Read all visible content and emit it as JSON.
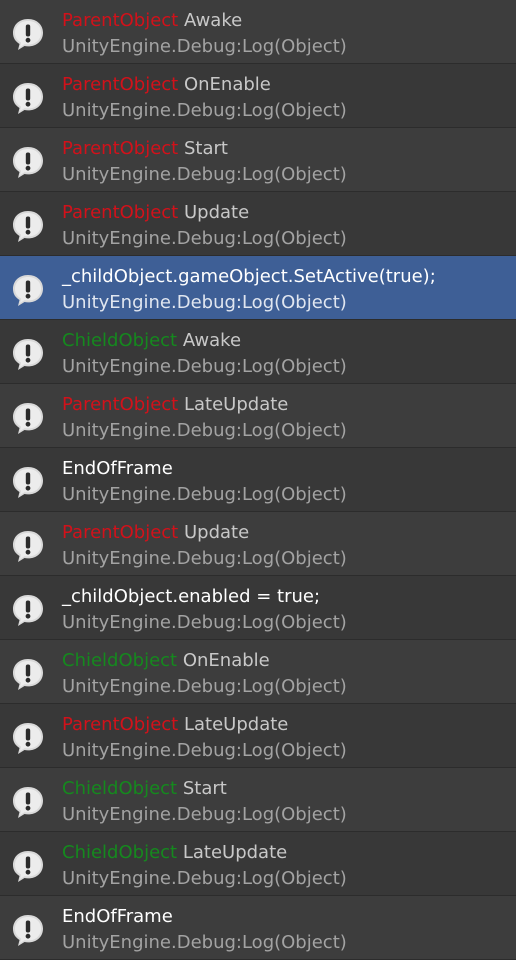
{
  "colors": {
    "parent": "#d2111a",
    "child": "#15891e",
    "message": "#c8c8c8",
    "plain": "#ffffff",
    "stack": "#a3a3a3",
    "selected_bg": "#3e5f96"
  },
  "icon": "log-info-icon",
  "entries": [
    {
      "type": "parent",
      "object": "ParentObject",
      "message": "Awake",
      "stack": "UnityEngine.Debug:Log(Object)"
    },
    {
      "type": "parent",
      "object": "ParentObject",
      "message": "OnEnable",
      "stack": "UnityEngine.Debug:Log(Object)"
    },
    {
      "type": "parent",
      "object": "ParentObject",
      "message": "Start",
      "stack": "UnityEngine.Debug:Log(Object)"
    },
    {
      "type": "parent",
      "object": "ParentObject",
      "message": "Update",
      "stack": "UnityEngine.Debug:Log(Object)"
    },
    {
      "type": "plain",
      "text": "_childObject.gameObject.SetActive(true);",
      "stack": "UnityEngine.Debug:Log(Object)",
      "selected": true
    },
    {
      "type": "child",
      "object": "ChieldObject",
      "message": "Awake",
      "stack": "UnityEngine.Debug:Log(Object)"
    },
    {
      "type": "parent",
      "object": "ParentObject",
      "message": "LateUpdate",
      "stack": "UnityEngine.Debug:Log(Object)"
    },
    {
      "type": "plain",
      "text": "EndOfFrame",
      "stack": "UnityEngine.Debug:Log(Object)"
    },
    {
      "type": "parent",
      "object": "ParentObject",
      "message": "Update",
      "stack": "UnityEngine.Debug:Log(Object)"
    },
    {
      "type": "plain",
      "text": "_childObject.enabled = true;",
      "stack": "UnityEngine.Debug:Log(Object)"
    },
    {
      "type": "child",
      "object": "ChieldObject",
      "message": "OnEnable",
      "stack": "UnityEngine.Debug:Log(Object)"
    },
    {
      "type": "parent",
      "object": "ParentObject",
      "message": "LateUpdate",
      "stack": "UnityEngine.Debug:Log(Object)"
    },
    {
      "type": "child",
      "object": "ChieldObject",
      "message": "Start",
      "stack": "UnityEngine.Debug:Log(Object)"
    },
    {
      "type": "child",
      "object": "ChieldObject",
      "message": "LateUpdate",
      "stack": "UnityEngine.Debug:Log(Object)"
    },
    {
      "type": "plain",
      "text": "EndOfFrame",
      "stack": "UnityEngine.Debug:Log(Object)"
    }
  ]
}
